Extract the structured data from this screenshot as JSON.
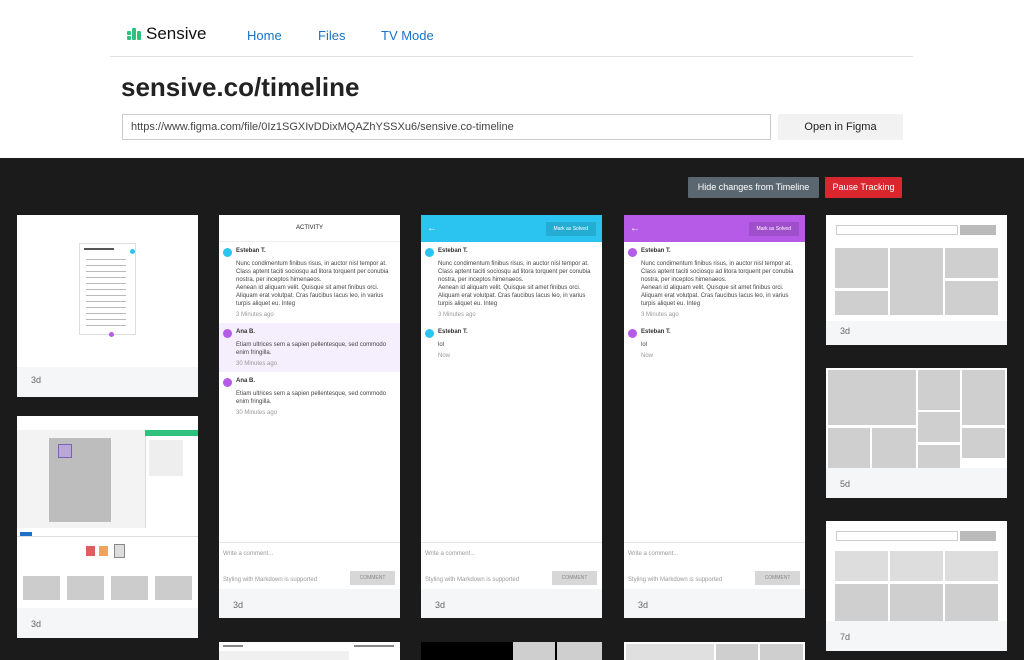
{
  "brand": {
    "name": "Sensive",
    "color": "#2ec27e"
  },
  "nav": {
    "home": "Home",
    "files": "Files",
    "tv_mode": "TV Mode"
  },
  "page": {
    "title": "sensive.co/timeline"
  },
  "url_input": {
    "value": "https://www.figma.com/file/0Iz1SGXIvDDixMQAZhYSSXu6/sensive.co-timeline"
  },
  "buttons": {
    "open_figma": "Open in Figma",
    "hide_changes": "Hide changes from Timeline",
    "pause": "Pause Tracking"
  },
  "colors": {
    "accent_blue": "#1a73c8",
    "hide_bg": "#5b6770",
    "pause_bg": "#d9262f",
    "cyan": "#2bc4f0",
    "purple": "#b55be8"
  },
  "activity": {
    "header": "ACTIVITY",
    "messages": [
      {
        "author": "Esteban T.",
        "text": "Nunc condimentum finibus risus, in auctor nisl tempor at. Class aptent taciti sociosqu ad litora torquent per conubia nostra, per inceptos himenaeos.\nAenean id aliquam velit. Quisque sit amet finibus orci. Aliquam erat volutpat. Cras faucibus lacus leo, in varius turpis aliquet eu. Integ",
        "time": "3 Minutes ago"
      },
      {
        "author": "Ana B.",
        "text": "Etiam ultrices sem a sapien pellentesque, sed commodo enim fringilla.",
        "time": "30 Minutes ago"
      },
      {
        "author": "Ana B.",
        "text": "Etiam ultrices sem a sapien pellentesque, sed commodo enim fringilla.",
        "time": "30 Minutes ago"
      }
    ],
    "comment_placeholder": "Write a comment...",
    "markdown_hint": "Styling with Markdown is supported",
    "comment_button": "COMMENT",
    "age": "3d"
  },
  "thread": {
    "mark_solved": "Mark as Solved",
    "messages": [
      {
        "author": "Esteban T.",
        "text": "Nunc condimentum finibus risus, in auctor nisl tempor at. Class aptent taciti sociosqu ad litora torquent per conubia nostra, per inceptos himenaeos.\nAenean id aliquam velit. Quisque sit amet finibus orci. Aliquam erat volutpat. Cras faucibus lacus leo, in varius turpis aliquet eu. Integ",
        "time": "3 Minutes ago"
      },
      {
        "author": "Esteban T.",
        "text": "lol",
        "time": "Now"
      }
    ],
    "age": "3d"
  },
  "cards": {
    "card1_age": "3d",
    "card2_age": "3d",
    "card3_age": "3d",
    "card4_age": "5d",
    "card5_age": "7d"
  }
}
